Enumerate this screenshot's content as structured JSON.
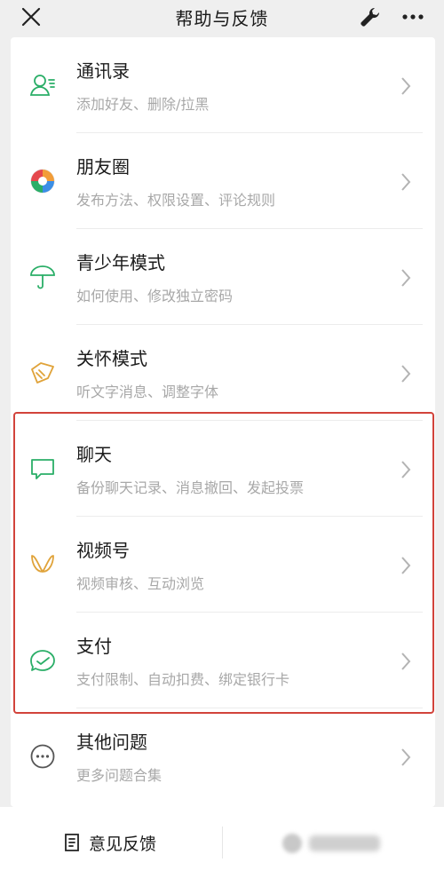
{
  "header": {
    "title": "帮助与反馈"
  },
  "items": [
    {
      "title": "通讯录",
      "subtitle": "添加好友、删除/拉黑",
      "icon": "contacts-icon",
      "color": "#2aae67"
    },
    {
      "title": "朋友圈",
      "subtitle": "发布方法、权限设置、评论规则",
      "icon": "moments-icon",
      "color": "#f29d38"
    },
    {
      "title": "青少年模式",
      "subtitle": "如何使用、修改独立密码",
      "icon": "umbrella-icon",
      "color": "#2aae67"
    },
    {
      "title": "关怀模式",
      "subtitle": "听文字消息、调整字体",
      "icon": "care-icon",
      "color": "#e0a33a"
    },
    {
      "title": "聊天",
      "subtitle": "备份聊天记录、消息撤回、发起投票",
      "icon": "chat-icon",
      "color": "#2aae67"
    },
    {
      "title": "视频号",
      "subtitle": "视频审核、互动浏览",
      "icon": "channels-icon",
      "color": "#e0a33a"
    },
    {
      "title": "支付",
      "subtitle": "支付限制、自动扣费、绑定银行卡",
      "icon": "pay-icon",
      "color": "#2aae67"
    },
    {
      "title": "其他问题",
      "subtitle": "更多问题合集",
      "icon": "more-circle-icon",
      "color": "#555555"
    }
  ],
  "footer": {
    "feedback_label": "意见反馈"
  },
  "colors": {
    "highlight": "#d2433b",
    "accent": "#2aae67"
  }
}
